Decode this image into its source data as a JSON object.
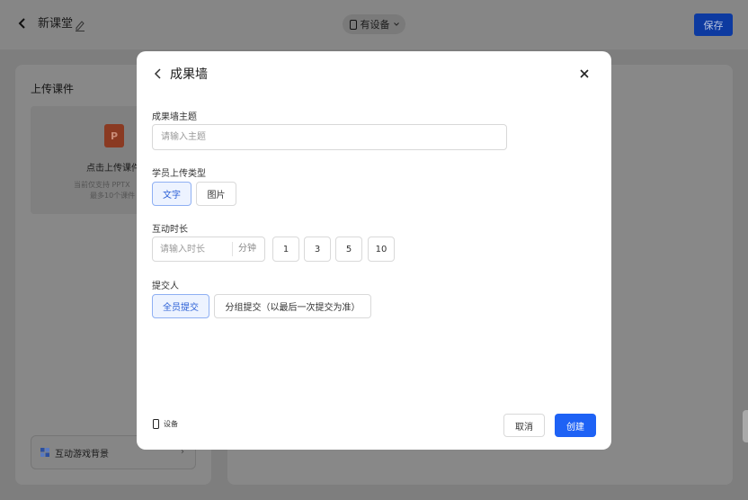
{
  "topbar": {
    "back_icon": "chevron-left-icon",
    "title": "新课堂",
    "edit_icon": "pencil-icon",
    "device_label": "有设备",
    "device_icon": "phone-icon",
    "dropdown_icon": "chevron-down-icon",
    "save_label": "保存",
    "save_color": "#1e62f5"
  },
  "left_panel": {
    "title": "上传课件",
    "upload_icon_letter": "P",
    "upload_label": "点击上传课件",
    "hint_line1": "当前仅支持 PPTX",
    "hint_line2": "最多10个课件",
    "game_bg_label": "互动游戏背景",
    "game_bg_chevron": "›"
  },
  "modal": {
    "title": "成果墙",
    "back_icon": "chevron-left-icon",
    "close_icon": "close-icon",
    "theme": {
      "label": "成果墙主题",
      "value": "",
      "placeholder": "请输入主题"
    },
    "upload_type": {
      "label": "学员上传类型",
      "options": [
        "文字",
        "图片"
      ],
      "selected": "文字"
    },
    "duration": {
      "label": "互动时长",
      "value": "",
      "placeholder": "请输入时长",
      "unit": "分钟",
      "presets": [
        "1",
        "3",
        "5",
        "10"
      ]
    },
    "submitter": {
      "label": "提交人",
      "options": [
        "全员提交",
        "分组提交（以最后一次提交为准）"
      ],
      "selected": "全员提交"
    },
    "footer": {
      "device_label": "设备",
      "cancel_label": "取消",
      "create_label": "创建",
      "accent": "#1e62f5"
    }
  }
}
